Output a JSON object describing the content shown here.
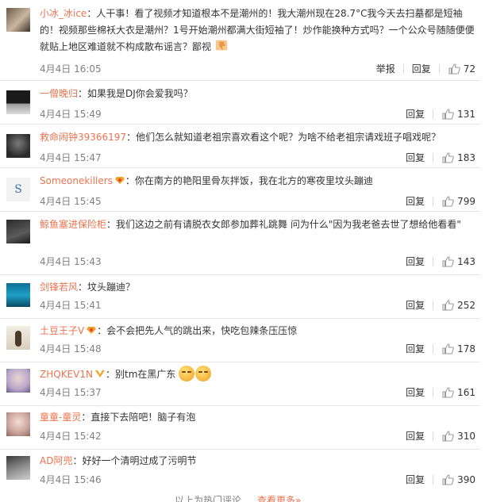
{
  "labels": {
    "report": "举报",
    "reply": "回复"
  },
  "comments": [
    {
      "user": "小冰_冰ice",
      "text": "人干事！看了视频才知道根本不是潮州的！我大潮州现在28.7°C我今天去扫墓都是短袖的！视频那些棉袄大衣是潮州？1号开始潮州都满大街短袖了！炒作能换种方式吗？一个公众号随随便便就贴上地区难道就不构成散布谣言？鄙视",
      "date": "4月4日 16:05",
      "likes": "72"
    },
    {
      "user": "一僧晚归",
      "text": "如果我是DJ你会爱我吗？",
      "date": "4月4日 15:49",
      "likes": "131"
    },
    {
      "user": "救命闹钟39366197",
      "text": "他们怎么就知道老祖宗喜欢看这个呢？为啥不给老祖宗请戏班子唱戏呢？",
      "date": "4月4日 15:47",
      "likes": "183"
    },
    {
      "user": "Someonekillers",
      "text": "你在南方的艳阳里骨灰拌饭，我在北方的寒夜里坟头蹦迪",
      "date": "4月4日 15:45",
      "likes": "799"
    },
    {
      "user": "鲸鱼塞进保险柜",
      "text": "我们这边之前有请脱衣女郎参加葬礼跳舞 问为什么\"因为我老爸去世了想给他看看\"",
      "date": "4月4日 15:43",
      "likes": "143"
    },
    {
      "user": "剑锋若风",
      "text": "坟头蹦迪？",
      "date": "4月4日 15:41",
      "likes": "252"
    },
    {
      "user": "土豆王子V",
      "text": "会不会把先人气的跳出来，快吃包辣条压压惊",
      "date": "4月4日 15:48",
      "likes": "178"
    },
    {
      "user": "ZHQKEV1N",
      "text": "别tm在黑广东",
      "date": "4月4日 15:37",
      "likes": "161"
    },
    {
      "user": "童童-童灵",
      "text": "直接下去陪吧！脑子有泡",
      "date": "4月4日 15:42",
      "likes": "310"
    },
    {
      "user": "AD阿兜",
      "text": "好好一个清明过成了污明节",
      "date": "4月4日 15:46",
      "likes": "390"
    }
  ],
  "footer": {
    "text": "以上为热门评论",
    "more": "查看更多»"
  },
  "colors": {
    "username": "#eb7350",
    "text": "#333333",
    "date": "#808080",
    "separator": "#e6e6e6"
  }
}
